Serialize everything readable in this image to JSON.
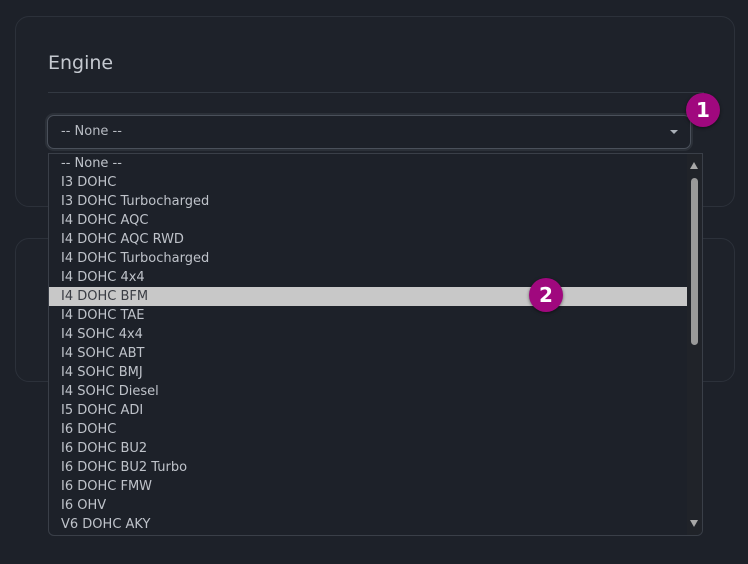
{
  "engine_card": {
    "title": "Engine",
    "select": {
      "value": "-- None --"
    }
  },
  "dropdown": {
    "options": [
      "-- None --",
      "I3 DOHC",
      "I3 DOHC Turbocharged",
      "I4 DOHC AQC",
      "I4 DOHC AQC RWD",
      "I4 DOHC Turbocharged",
      "I4 DOHC 4x4",
      "I4 DOHC BFM",
      "I4 DOHC TAE",
      "I4 SOHC 4x4",
      "I4 SOHC ABT",
      "I4 SOHC BMJ",
      "I4 SOHC Diesel",
      "I5 DOHC ADI",
      "I6 DOHC",
      "I6 DOHC BU2",
      "I6 DOHC BU2 Turbo",
      "I6 DOHC FMW",
      "I6 OHV",
      "V6 DOHC AKY"
    ],
    "highlighted": "I4 DOHC BFM"
  },
  "badges": [
    "1",
    "2"
  ],
  "colors": {
    "badge": "#a0087e",
    "highlight": "#c8c8c8",
    "background": "#1d2129"
  }
}
